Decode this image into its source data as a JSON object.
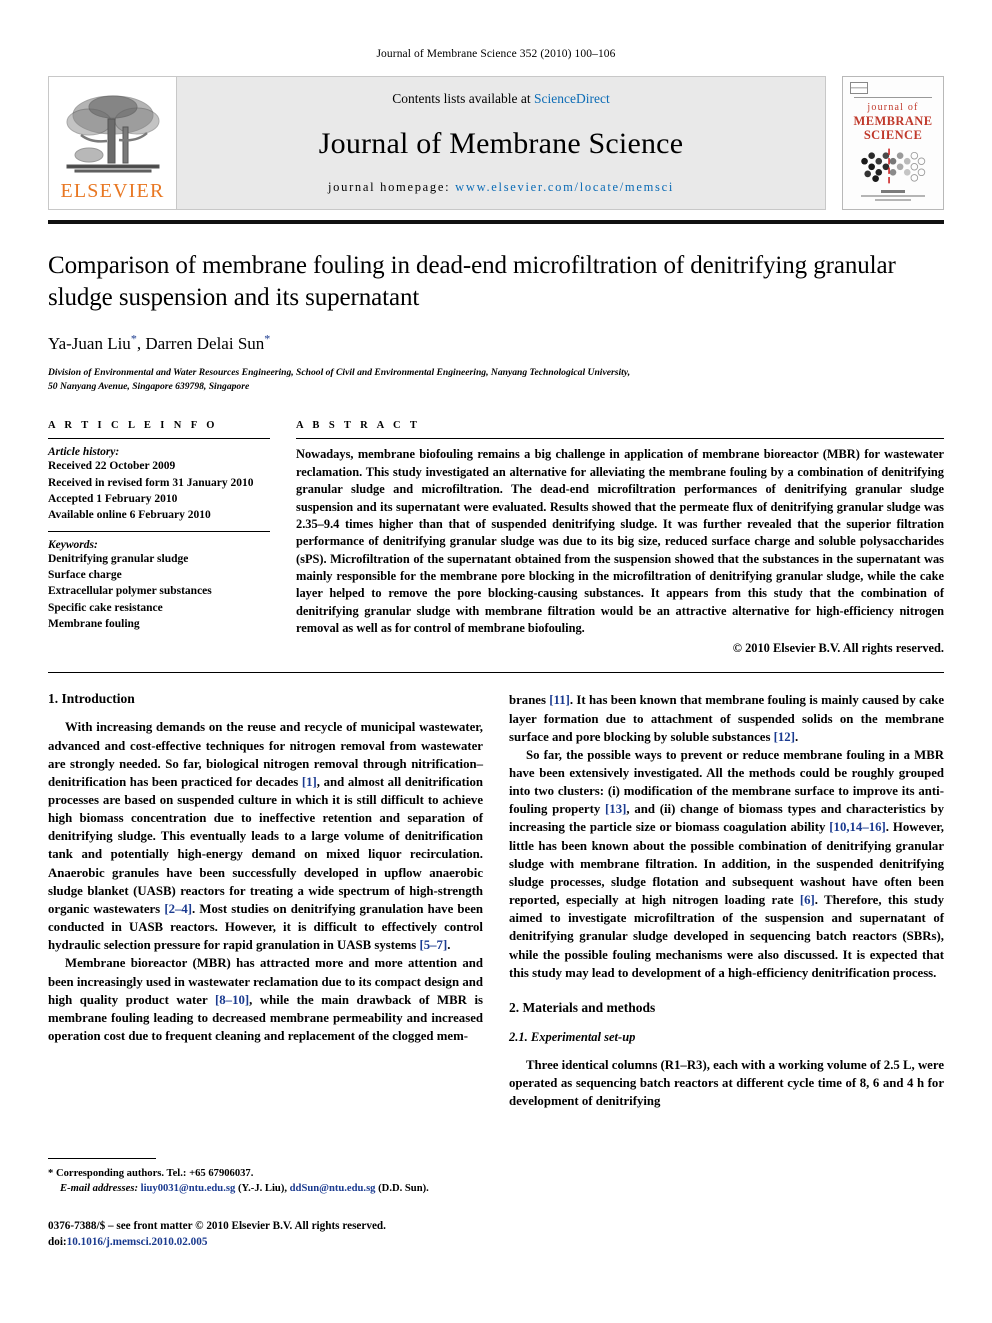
{
  "running_head": "Journal of Membrane Science 352 (2010) 100–106",
  "masthead": {
    "contents_prefix": "Contents lists available at ",
    "sciencedirect": "ScienceDirect",
    "journal_title": "Journal of Membrane Science",
    "homepage_prefix": "journal homepage: ",
    "homepage_url": "www.elsevier.com/locate/memsci",
    "publisher": "ELSEVIER",
    "cover": {
      "line1": "journal of",
      "line2": "MEMBRANE",
      "line3": "SCIENCE"
    }
  },
  "title": "Comparison of membrane fouling in dead-end microfiltration of denitrifying granular sludge suspension and its supernatant",
  "authors": "Ya-Juan Liu, Darren Delai Sun",
  "author_marks": "*",
  "affiliation_line1": "Division of Environmental and Water Resources Engineering, School of Civil and Environmental Engineering, Nanyang Technological University,",
  "affiliation_line2": "50 Nanyang Avenue, Singapore 639798, Singapore",
  "article_info": {
    "heading": "A R T I C L E    I N F O",
    "history_label": "Article history:",
    "history": [
      "Received 22 October 2009",
      "Received in revised form 31 January 2010",
      "Accepted 1 February 2010",
      "Available online 6 February 2010"
    ],
    "keywords_label": "Keywords:",
    "keywords": [
      "Denitrifying granular sludge",
      "Surface charge",
      "Extracellular polymer substances",
      "Specific cake resistance",
      "Membrane fouling"
    ]
  },
  "abstract": {
    "heading": "A B S T R A C T",
    "text": "Nowadays, membrane biofouling remains a big challenge in application of membrane bioreactor (MBR) for wastewater reclamation. This study investigated an alternative for alleviating the membrane fouling by a combination of denitrifying granular sludge and microfiltration. The dead-end microfiltration performances of denitrifying granular sludge suspension and its supernatant were evaluated. Results showed that the permeate flux of denitrifying granular sludge was 2.35–9.4 times higher than that of suspended denitrifying sludge. It was further revealed that the superior filtration performance of denitrifying granular sludge was due to its big size, reduced surface charge and soluble polysaccharides (sPS). Microfiltration of the supernatant obtained from the suspension showed that the substances in the supernatant was mainly responsible for the membrane pore blocking in the microfiltration of denitrifying granular sludge, while the cake layer helped to remove the pore blocking-causing substances. It appears from this study that the combination of denitrifying granular sludge with membrane filtration would be an attractive alternative for high-efficiency nitrogen removal as well as for control of membrane biofouling.",
    "copyright": "© 2010 Elsevier B.V. All rights reserved."
  },
  "sections": {
    "intro_heading": "1.  Introduction",
    "intro_p1": "With increasing demands on the reuse and recycle of municipal wastewater, advanced and cost-effective techniques for nitrogen removal from wastewater are strongly needed. So far, biological nitrogen removal through nitrification–denitrification has been practiced for decades [1], and almost all denitrification processes are based on suspended culture in which it is still difficult to achieve high biomass concentration due to ineffective retention and separation of denitrifying sludge. This eventually leads to a large volume of denitrification tank and potentially high-energy demand on mixed liquor recirculation. Anaerobic granules have been successfully developed in upflow anaerobic sludge blanket (UASB) reactors for treating a wide spectrum of high-strength organic wastewaters [2–4]. Most studies on denitrifying granulation have been conducted in UASB reactors. However, it is difficult to effectively control hydraulic selection pressure for rapid granulation in UASB systems [5–7].",
    "intro_p2": "Membrane bioreactor (MBR) has attracted more and more attention and been increasingly used in wastewater reclamation due to its compact design and high quality product water [8–10], while the main drawback of MBR is membrane fouling leading to decreased membrane permeability and increased operation cost due to frequent cleaning and replacement of the clogged membranes [11]. It has been known that membrane fouling is mainly caused by cake layer formation due to attachment of suspended solids on the membrane surface and pore blocking by soluble substances [12].",
    "intro_p3": "So far, the possible ways to prevent or reduce membrane fouling in a MBR have been extensively investigated. All the methods could be roughly grouped into two clusters: (i) modification of the membrane surface to improve its anti-fouling property [13], and (ii) change of biomass types and characteristics by increasing the particle size or biomass coagulation ability [10,14–16]. However, little has been known about the possible combination of denitrifying granular sludge with membrane filtration. In addition, in the suspended denitrifying sludge processes, sludge flotation and subsequent washout have often been reported, especially at high nitrogen loading rate [6]. Therefore, this study aimed to investigate microfiltration of the suspension and supernatant of denitrifying granular sludge developed in sequencing batch reactors (SBRs), while the possible fouling mechanisms were also discussed. It is expected that this study may lead to development of a high-efficiency denitrification process.",
    "materials_heading": "2.  Materials and methods",
    "subsec_heading": "2.1.  Experimental set-up",
    "materials_p1": "Three identical columns (R1–R3), each with a working volume of 2.5 L, were operated as sequencing batch reactors at different cycle time of 8, 6 and 4 h for development of denitrifying"
  },
  "footnotes": {
    "corresponding": "* Corresponding authors. Tel.: +65 67906037.",
    "email_label": "E-mail addresses:",
    "email1": "liuy0031@ntu.edu.sg",
    "email1_owner": "(Y.-J. Liu),",
    "email2": "ddSun@ntu.edu.sg",
    "email2_owner": "(D.D. Sun)."
  },
  "issn_line": "0376-7388/$ – see front matter © 2010 Elsevier B.V. All rights reserved.",
  "doi_prefix": "doi:",
  "doi_value": "10.1016/j.memsci.2010.02.005",
  "colors": {
    "elsevier_orange": "#e87722",
    "link_blue": "#0b6bb5",
    "ref_blue": "#1a3a8f",
    "cover_red": "#c0392b"
  }
}
